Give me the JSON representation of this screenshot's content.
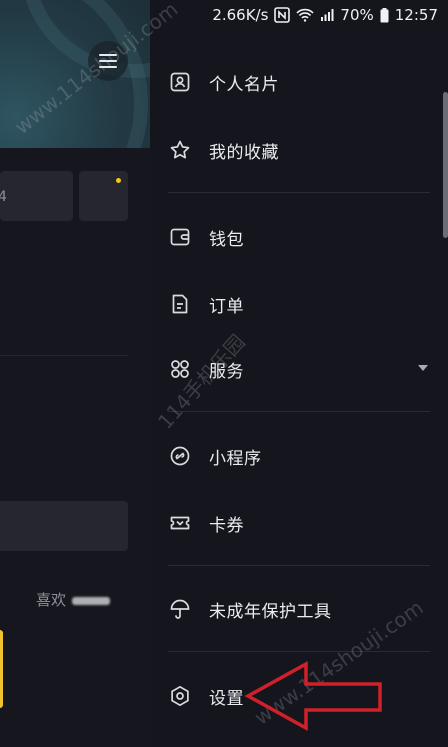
{
  "status_bar": {
    "speed": "2.66K/s",
    "battery": "70%",
    "time": "12:57"
  },
  "background_page": {
    "like_label": "喜欢"
  },
  "drawer": {
    "items": [
      {
        "label": "个人名片",
        "icon": "profile-card-icon"
      },
      {
        "label": "我的收藏",
        "icon": "star-icon"
      },
      {
        "label": "钱包",
        "icon": "wallet-icon"
      },
      {
        "label": "订单",
        "icon": "order-icon"
      },
      {
        "label": "服务",
        "icon": "services-icon"
      },
      {
        "label": "小程序",
        "icon": "mini-program-icon"
      },
      {
        "label": "卡券",
        "icon": "coupon-icon"
      },
      {
        "label": "未成年保护工具",
        "icon": "umbrella-icon"
      },
      {
        "label": "设置",
        "icon": "gear-icon"
      }
    ]
  },
  "watermarks": [
    "www.114shouji.com",
    "114手机乐园",
    "www.114shouji.com"
  ],
  "colors": {
    "drawer_bg": "#15161d",
    "annotation_arrow": "#d0202a",
    "notification_dot": "#f5c518"
  }
}
